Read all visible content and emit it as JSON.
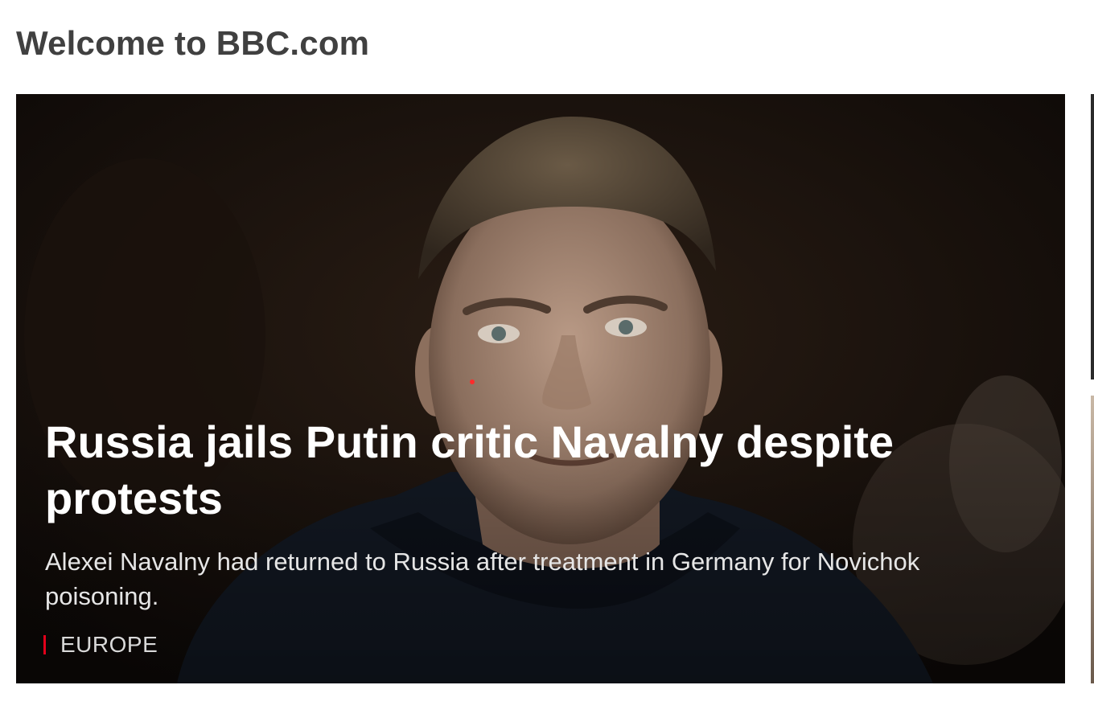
{
  "page": {
    "title": "Welcome to BBC.com"
  },
  "hero": {
    "headline": "Russia jails Putin critic Navalny despite protests",
    "summary": "Alexei Navalny had returned to Russia after treatment in Germany for Novichok poisoning.",
    "section": "EUROPE",
    "accent_color": "#e2001a"
  }
}
